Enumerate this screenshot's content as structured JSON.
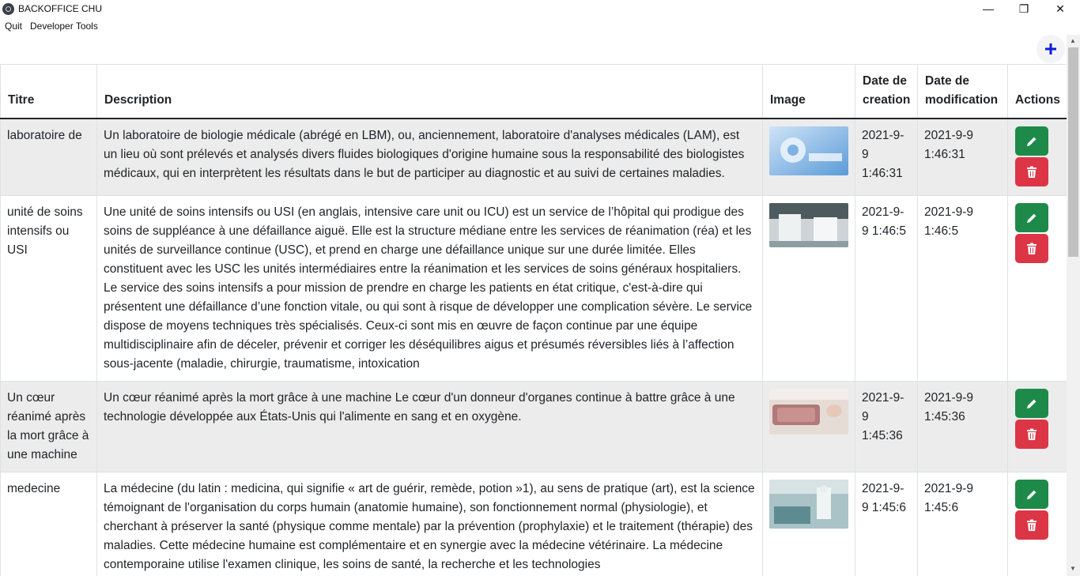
{
  "window": {
    "title": "BACKOFFICE CHU",
    "minimize": "—",
    "maximize": "❐",
    "close": "✕"
  },
  "menu": {
    "items": [
      "Quit",
      "Developer Tools"
    ]
  },
  "add_button": {
    "icon": "plus-icon",
    "color": "#0d1ed6"
  },
  "table": {
    "headers": [
      "Titre",
      "Description",
      "Image",
      "Date de creation",
      "Date de modification",
      "Actions"
    ],
    "rows": [
      {
        "title": "laboratoire de",
        "description": "Un laboratoire de biologie médicale (abrégé en LBM), ou, anciennement, laboratoire d'analyses médicales (LAM), est un lieu où sont prélevés et analysés divers fluides biologiques d'origine humaine sous la responsabilité des biologistes médicaux, qui en interprètent les résultats dans le but de participer au diagnostic et au suivi de certaines maladies.",
        "image": "lab-photo",
        "created": "2021-9-9 1:46:31",
        "modified": "2021-9-9 1:46:31"
      },
      {
        "title": "unité de soins intensifs ou USI",
        "description": "Une unité de soins intensifs ou USI (en anglais, intensive care unit ou ICU) est un service de l’hôpital qui prodigue des soins de suppléance à une défaillance aiguë. Elle est la structure médiane entre les services de réanimation (réa) et les unités de surveillance continue (USC), et prend en charge une défaillance unique sur une durée limitée. Elles constituent avec les USC les unités intermédiaires entre la réanimation et les services de soins généraux hospitaliers. Le service des soins intensifs a pour mission de prendre en charge les patients en état critique, c'est-à-dire qui présentent une défaillance d’une fonction vitale, ou qui sont à risque de développer une complication sévère. Le service dispose de moyens techniques très spécialisés. Ceux-ci sont mis en œuvre de façon continue par une équipe multidisciplinaire afin de déceler, prévenir et corriger les déséquilibres aigus et présumés réversibles liés à l’affection sous-jacente (maladie, chirurgie, traumatisme, intoxication",
        "image": "icu-photo",
        "created": "2021-9-9 1:46:5",
        "modified": "2021-9-9 1:46:5"
      },
      {
        "title": "Un cœur réanimé après la mort grâce à une machine",
        "description": "Un cœur réanimé après la mort grâce à une machine Le cœur d'un donneur d'organes continue à battre grâce à une technologie développée aux États-Unis qui l'alimente en sang et en oxygène.",
        "image": "heart-photo",
        "created": "2021-9-9 1:45:36",
        "modified": "2021-9-9 1:45:36"
      },
      {
        "title": "medecine",
        "description": "La médecine (du latin : medicina, qui signifie « art de guérir, remède, potion »1), au sens de pratique (art), est la science témoignant de l'organisation du corps humain (anatomie humaine), son fonctionnement normal (physiologie), et cherchant à préserver la santé (physique comme mentale) par la prévention (prophylaxie) et le traitement (thérapie) des maladies. Cette médecine humaine est complémentaire et en synergie avec la médecine vétérinaire. La médecine contemporaine utilise l'examen clinique, les soins de santé, la recherche et les technologies",
        "image": "medicine-photo",
        "created": "2021-9-9 1:45:6",
        "modified": "2021-9-9 1:45:6"
      }
    ]
  },
  "colors": {
    "edit": "#1e8a4a",
    "delete": "#dc3545",
    "stripe": "#ececec"
  }
}
